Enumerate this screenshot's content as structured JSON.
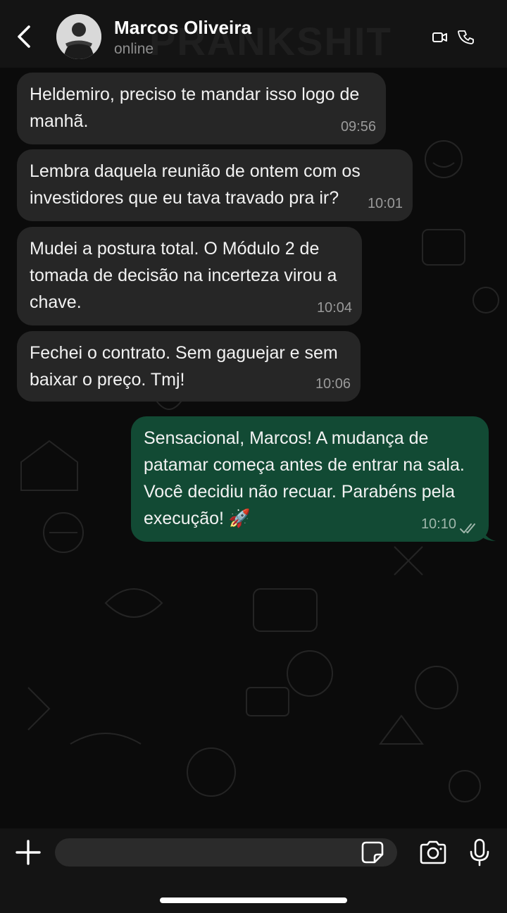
{
  "header": {
    "contact_name": "Marcos Oliveira",
    "status": "online"
  },
  "watermark": "PRANKSHIT",
  "messages": [
    {
      "direction": "incoming",
      "text": "Heldemiro, preciso te mandar isso logo de\nmanhã.",
      "time": "09:56"
    },
    {
      "direction": "incoming",
      "text": "Lembra daquela reunião de ontem com os\ninvestidores que eu tava travado pra ir?",
      "time": "10:01"
    },
    {
      "direction": "incoming",
      "text": "Mudei a postura total. O Módulo 2 de\ntomada de decisão na incerteza virou a\nchave.",
      "time": "10:04"
    },
    {
      "direction": "incoming",
      "text": "Fechei o contrato. Sem gaguejar e sem\nbaixar o preço. Tmj!",
      "time": "10:06"
    },
    {
      "direction": "outgoing",
      "text": "Sensacional, Marcos! A mudança de\npatamar começa antes de entrar na sala.\nVocê decidiu não recuar. Parabéns pela\nexecução! 🚀",
      "time": "10:10",
      "status": "read"
    }
  ],
  "colors": {
    "header_bg": "#141414",
    "incoming_bubble": "#262626",
    "outgoing_bubble": "#124a34",
    "read_ticks": "#9fb6ab"
  },
  "icons": [
    "back-chevron-icon",
    "video-call-icon",
    "phone-icon",
    "plus-icon",
    "sticker-icon",
    "camera-icon",
    "microphone-icon",
    "double-check-icon"
  ]
}
